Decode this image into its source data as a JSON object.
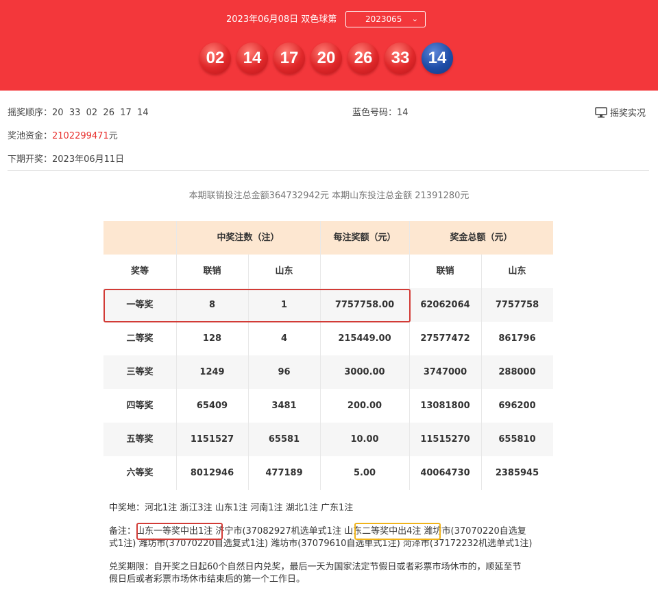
{
  "header": {
    "draw_title": "2023年06月08日 双色球第",
    "issue_select": "2023065",
    "red_balls": [
      "02",
      "14",
      "17",
      "20",
      "26",
      "33"
    ],
    "blue_ball": "14"
  },
  "info": {
    "order_label": "摇奖顺序：",
    "order_value": "20  33  02  26  17  14",
    "blue_label": "蓝色号码：",
    "blue_value": "14",
    "pool_label": "奖池资金：",
    "pool_value": "2102299471",
    "pool_unit": "元",
    "next_label": "下期开奖：",
    "next_value": "2023年06月11日",
    "live_label": "摇奖实况"
  },
  "sales_line": "本期联销投注总金额364732942元 本期山东投注总金额 21391280元",
  "table": {
    "group_headers": {
      "winners": "中奖注数（注）",
      "per_prize": "每注奖额（元）",
      "total": "奖金总额（元）"
    },
    "sub_headers": [
      "奖等",
      "联销",
      "山东",
      "",
      "联销",
      "山东"
    ],
    "rows": [
      {
        "level": "一等奖",
        "winners_all": "8",
        "winners_sd": "1",
        "per": "7757758.00",
        "total_all": "62062064",
        "total_sd": "7757758"
      },
      {
        "level": "二等奖",
        "winners_all": "128",
        "winners_sd": "4",
        "per": "215449.00",
        "total_all": "27577472",
        "total_sd": "861796"
      },
      {
        "level": "三等奖",
        "winners_all": "1249",
        "winners_sd": "96",
        "per": "3000.00",
        "total_all": "3747000",
        "total_sd": "288000"
      },
      {
        "level": "四等奖",
        "winners_all": "65409",
        "winners_sd": "3481",
        "per": "200.00",
        "total_all": "13081800",
        "total_sd": "696200"
      },
      {
        "level": "五等奖",
        "winners_all": "1151527",
        "winners_sd": "65581",
        "per": "10.00",
        "total_all": "11515270",
        "total_sd": "655810"
      },
      {
        "level": "六等奖",
        "winners_all": "8012946",
        "winners_sd": "477189",
        "per": "5.00",
        "total_all": "40064730",
        "total_sd": "2385945"
      }
    ]
  },
  "notes": {
    "winners_place": "中奖地：河北1注 浙江3注 山东1注 河南1注 湖北1注 广东1注",
    "remark_label": "备注：",
    "remark_hl1": "山东一等奖中出1注",
    "remark_mid1": "济宁市(37082927机选单式1注",
    "remark_hl2": "山东二等奖中出4注",
    "remark_mid2": "潍坊市(37070220自选复",
    "remark_line2": "式1注) 潍坊市(37070220自选复式1注) 潍坊市(37079610自选单式1注) 菏泽市(37172232机选单式1注)",
    "deadline_line1": "兑奖期限：自开奖之日起60个自然日内兑奖，最后一天为国家法定节假日或者彩票市场休市的，顺延至节",
    "deadline_line2": "假日后或者彩票市场休市结束后的第一个工作日。"
  }
}
